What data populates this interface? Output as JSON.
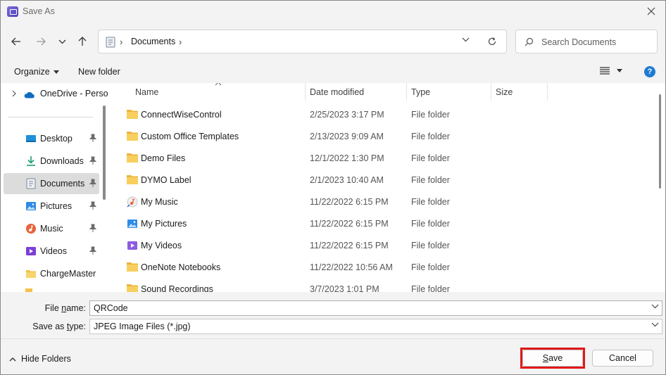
{
  "window": {
    "title": "Save As"
  },
  "address": {
    "crumbs": [
      "Documents"
    ]
  },
  "search": {
    "placeholder": "Search Documents"
  },
  "toolbar": {
    "organize_label": "Organize",
    "new_folder_label": "New folder",
    "help_label": "?"
  },
  "nav": {
    "onedrive": "OneDrive - Perso",
    "items": [
      {
        "label": "Desktop",
        "icon": "desktop-icon",
        "pinned": true
      },
      {
        "label": "Downloads",
        "icon": "downloads-icon",
        "pinned": true
      },
      {
        "label": "Documents",
        "icon": "documents-icon",
        "pinned": true,
        "selected": true
      },
      {
        "label": "Pictures",
        "icon": "pictures-icon",
        "pinned": true
      },
      {
        "label": "Music",
        "icon": "music-icon",
        "pinned": true
      },
      {
        "label": "Videos",
        "icon": "videos-icon",
        "pinned": true
      },
      {
        "label": "ChargeMaster",
        "icon": "folder-icon",
        "pinned": false
      }
    ]
  },
  "columns": {
    "name": "Name",
    "date": "Date modified",
    "type": "Type",
    "size": "Size"
  },
  "files": [
    {
      "name": "ConnectWiseControl",
      "date": "2/25/2023 3:17 PM",
      "type": "File folder",
      "icon": "folder-icon"
    },
    {
      "name": "Custom Office Templates",
      "date": "2/13/2023 9:09 AM",
      "type": "File folder",
      "icon": "folder-icon"
    },
    {
      "name": "Demo Files",
      "date": "12/1/2022 1:30 PM",
      "type": "File folder",
      "icon": "folder-icon"
    },
    {
      "name": "DYMO Label",
      "date": "2/1/2023 10:40 AM",
      "type": "File folder",
      "icon": "folder-icon"
    },
    {
      "name": "My Music",
      "date": "11/22/2022 6:15 PM",
      "type": "File folder",
      "icon": "music-shortcut-icon"
    },
    {
      "name": "My Pictures",
      "date": "11/22/2022 6:15 PM",
      "type": "File folder",
      "icon": "pictures-shortcut-icon"
    },
    {
      "name": "My Videos",
      "date": "11/22/2022 6:15 PM",
      "type": "File folder",
      "icon": "videos-shortcut-icon"
    },
    {
      "name": "OneNote Notebooks",
      "date": "11/22/2022 10:56 AM",
      "type": "File folder",
      "icon": "folder-icon"
    },
    {
      "name": "Sound Recordings",
      "date": "3/7/2023 1:01 PM",
      "type": "File folder",
      "icon": "folder-icon"
    }
  ],
  "form": {
    "file_name_label_pre": "File ",
    "file_name_label_ul": "n",
    "file_name_label_post": "ame:",
    "file_name_value": "QRCode",
    "save_type_label_pre": "Save as ",
    "save_type_label_ul": "t",
    "save_type_label_post": "ype:",
    "save_type_value": "JPEG Image Files (*.jpg)"
  },
  "footer": {
    "hide_folders_label": "Hide Folders",
    "save_ul": "S",
    "save_rest": "ave",
    "cancel_label": "Cancel"
  },
  "colors": {
    "accent": "#1f7bd2",
    "folder": "#f4c14a",
    "highlight_frame": "#e01818"
  }
}
